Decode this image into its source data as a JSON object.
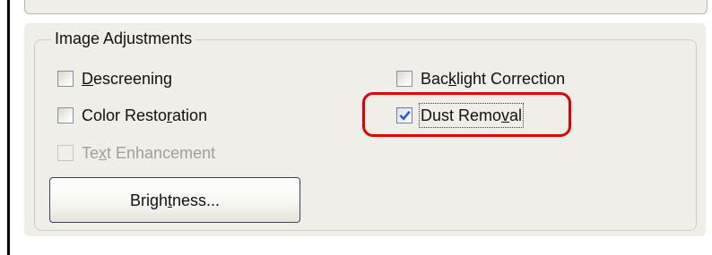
{
  "group": {
    "title": "Image Adjustments"
  },
  "options": {
    "descreening": {
      "before": "",
      "mnemonic": "D",
      "after": "escreening",
      "checked": false,
      "enabled": true
    },
    "color_restoration": {
      "before": "Color Resto",
      "mnemonic": "r",
      "after": "ation",
      "checked": false,
      "enabled": true
    },
    "text_enhancement": {
      "before": "Te",
      "mnemonic": "x",
      "after": "t Enhancement",
      "checked": false,
      "enabled": false
    },
    "backlight_correction": {
      "before": "Bac",
      "mnemonic": "k",
      "after": "light Correction",
      "checked": false,
      "enabled": true
    },
    "dust_removal": {
      "before": "Dust Remo",
      "mnemonic": "v",
      "after": "al",
      "checked": true,
      "enabled": true,
      "focused": true
    }
  },
  "button": {
    "before": "Brigh",
    "mnemonic": "t",
    "after": "ness..."
  },
  "colors": {
    "panel": "#efeee8",
    "highlight": "#e10000",
    "check": "#2f58d8"
  },
  "icons": {
    "checkbox": "checkbox-icon",
    "checkmark": "checkmark-icon"
  }
}
